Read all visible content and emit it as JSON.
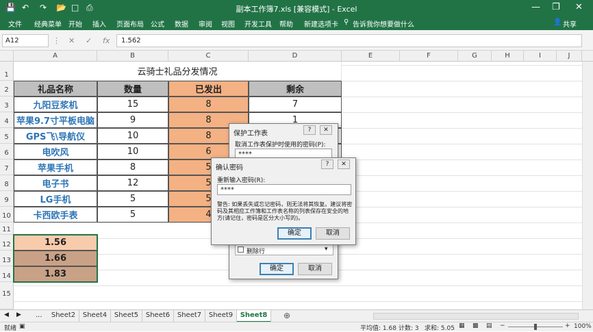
{
  "app": {
    "title": "副本工作簿7.xls  [兼容模式]  -  Excel"
  },
  "ribbon": {
    "tabs": [
      "文件",
      "经典菜单",
      "开始",
      "插入",
      "页面布局",
      "公式",
      "数据",
      "审阅",
      "视图",
      "开发工具",
      "帮助",
      "新建选项卡"
    ],
    "tell_me": "告诉我你想要做什么",
    "share": "共享"
  },
  "formula_bar": {
    "name_box": "A12",
    "fx": "fx",
    "value": "1.562"
  },
  "columns": [
    "A",
    "B",
    "C",
    "D",
    "E",
    "F",
    "G",
    "H",
    "I",
    "J"
  ],
  "rows": [
    "1",
    "2",
    "3",
    "4",
    "5",
    "6",
    "7",
    "8",
    "9",
    "10",
    "11",
    "12",
    "13",
    "14",
    "15"
  ],
  "table": {
    "title": "云骑士礼品分发情况",
    "headers": [
      "礼品名称",
      "数量",
      "已发出",
      "剩余"
    ],
    "rows": [
      [
        "九阳豆浆机",
        "15",
        "8",
        "7"
      ],
      [
        "苹果9.7寸平板电脑",
        "9",
        "8",
        "1"
      ],
      [
        "GPS飞\\导航仪",
        "10",
        "8",
        ""
      ],
      [
        "电吹风",
        "10",
        "6",
        ""
      ],
      [
        "苹果手机",
        "8",
        "5",
        ""
      ],
      [
        "电子书",
        "12",
        "5",
        ""
      ],
      [
        "LG手机",
        "5",
        "5",
        ""
      ],
      [
        "卡西欧手表",
        "5",
        "4",
        ""
      ]
    ],
    "extra": [
      "1.56",
      "1.66",
      "1.83"
    ]
  },
  "colors": {
    "accent": "#217346",
    "orange": "#f4b183",
    "header_gray": "#bfbfbf",
    "blue_text": "#2e75b6"
  },
  "sheets": [
    "Sheet2",
    "Sheet4",
    "Sheet5",
    "Sheet6",
    "Sheet7",
    "Sheet9",
    "Sheet8"
  ],
  "active_sheet": "Sheet8",
  "status": {
    "mode": "就绪",
    "average": "平均值: 1.68",
    "count": "计数: 3",
    "sum": "求和: 5.05",
    "zoom": "100%"
  },
  "protect_dialog": {
    "title": "保护工作表",
    "password_label": "取消工作表保护时使用的密码(P):",
    "password_value": "****",
    "option_delete_rows": "删除行",
    "ok": "确定",
    "cancel": "取消"
  },
  "confirm_dialog": {
    "title": "确认密码",
    "label": "重新输入密码(R):",
    "value": "****",
    "warning": "警告: 如果丢失或忘记密码，则无法将其恢复。建议将密码及其相应工作簿和工作表名称的列表保存在安全的地方(请记住，密码是区分大小写的)。",
    "ok": "确定",
    "cancel": "取消"
  }
}
